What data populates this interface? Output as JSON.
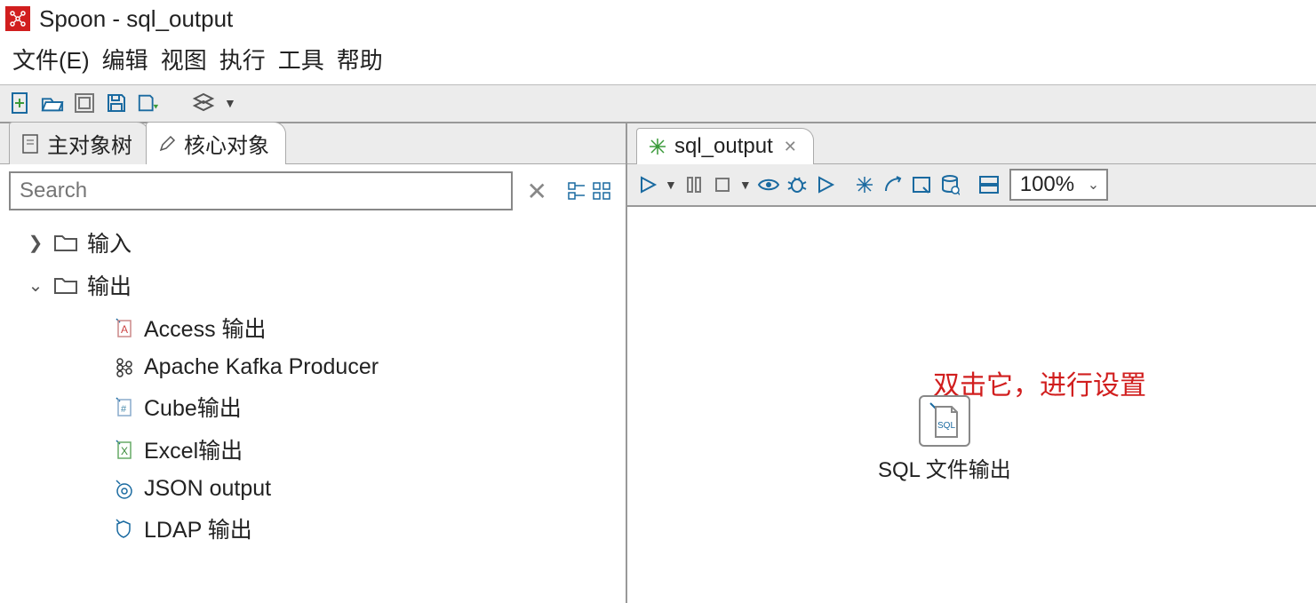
{
  "title": "Spoon - sql_output",
  "menu": [
    "文件(E)",
    "编辑",
    "视图",
    "执行",
    "工具",
    "帮助"
  ],
  "leftTabs": [
    {
      "label": "主对象树",
      "icon": "document-icon",
      "active": false
    },
    {
      "label": "核心对象",
      "icon": "pencil-icon",
      "active": true
    }
  ],
  "search": {
    "placeholder": "Search"
  },
  "tree": {
    "nodes": [
      {
        "type": "folder",
        "label": "输入",
        "expanded": false,
        "level": 1
      },
      {
        "type": "folder",
        "label": "输出",
        "expanded": true,
        "level": 1
      },
      {
        "type": "leaf",
        "label": "Access 输出",
        "icon": "access-icon",
        "level": 2
      },
      {
        "type": "leaf",
        "label": "Apache Kafka Producer",
        "icon": "kafka-icon",
        "level": 2
      },
      {
        "type": "leaf",
        "label": "Cube输出",
        "icon": "cube-icon",
        "level": 2
      },
      {
        "type": "leaf",
        "label": "Excel输出",
        "icon": "excel-icon",
        "level": 2
      },
      {
        "type": "leaf",
        "label": "JSON output",
        "icon": "json-icon",
        "level": 2
      },
      {
        "type": "leaf",
        "label": "LDAP 输出",
        "icon": "ldap-icon",
        "level": 2
      }
    ]
  },
  "rightTab": {
    "label": "sql_output"
  },
  "zoom": "100%",
  "canvas": {
    "annotation": "双击它，进行设置",
    "stepLabel": "SQL 文件输出"
  }
}
